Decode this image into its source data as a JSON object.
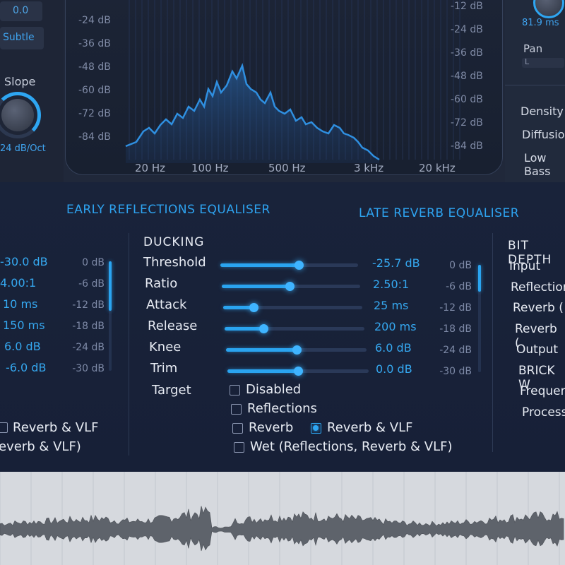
{
  "top": {
    "left_value": "0.0",
    "left_button": "Subtle",
    "slope_label": "Slope",
    "slope_value": "24 dB/Oct",
    "db_scale_left": [
      "-24 dB",
      "-36 dB",
      "-48 dB",
      "-60 dB",
      "-72 dB",
      "-84 dB"
    ],
    "db_scale_right": [
      "-12 dB",
      "-24 dB",
      "-36 dB",
      "-48 dB",
      "-60 dB",
      "-72 dB",
      "-84 dB"
    ],
    "freq_labels": [
      "20 Hz",
      "100 Hz",
      "500 Hz",
      "3 kHz",
      "20 kHz"
    ],
    "right_value": "81.9 ms",
    "pan_label": "Pan",
    "pan_value": "L",
    "right_params": [
      "Density",
      "Diffusion",
      "Low Bass"
    ]
  },
  "tabs": {
    "early": "EARLY REFLECTIONS EQUALISER",
    "late": "LATE REVERB EQUALISER"
  },
  "left_comp": {
    "values": [
      "-30.0 dB",
      "4.00:1",
      "10 ms",
      "150 ms",
      "6.0 dB",
      "-6.0 dB"
    ],
    "scale": [
      "0 dB",
      "-6 dB",
      "-12 dB",
      "-18 dB",
      "-24 dB",
      "-30 dB"
    ],
    "meter_fraction": 0.45,
    "targets": [
      "Reverb & VLF",
      "everb & VLF)"
    ]
  },
  "ducking": {
    "title": "DUCKING",
    "rows": [
      {
        "label": "Threshold",
        "value": "-25.7 dB",
        "fraction": 0.57
      },
      {
        "label": "Ratio",
        "value": "2.50:1",
        "fraction": 0.49
      },
      {
        "label": "Attack",
        "value": "25 ms",
        "fraction": 0.22
      },
      {
        "label": "Release",
        "value": "200 ms",
        "fraction": 0.28
      },
      {
        "label": "Knee",
        "value": "6.0 dB",
        "fraction": 0.5
      },
      {
        "label": "Trim",
        "value": "0.0 dB",
        "fraction": 0.5
      }
    ],
    "scale": [
      "0 dB",
      "-6 dB",
      "-12 dB",
      "-18 dB",
      "-24 dB",
      "-30 dB"
    ],
    "meter_fraction": 0.25,
    "target_label": "Target",
    "targets": [
      {
        "label": "Disabled",
        "checked": false
      },
      {
        "label": "Reflections",
        "checked": false
      },
      {
        "label": "Reverb",
        "checked": false
      },
      {
        "label": "Reverb & VLF",
        "checked": true
      },
      {
        "label": "Wet (Reflections, Reverb & VLF)",
        "checked": false
      }
    ]
  },
  "bit_depth": {
    "title": "BIT DEPTH",
    "items": [
      "Input",
      "Reflections",
      "Reverb (",
      "Reverb (",
      "Output",
      "BRICK W",
      "Frequency",
      "Process"
    ]
  },
  "colors": {
    "accent": "#2ea6f2",
    "panel": "#19233a",
    "waveform": "#5b5f66"
  }
}
